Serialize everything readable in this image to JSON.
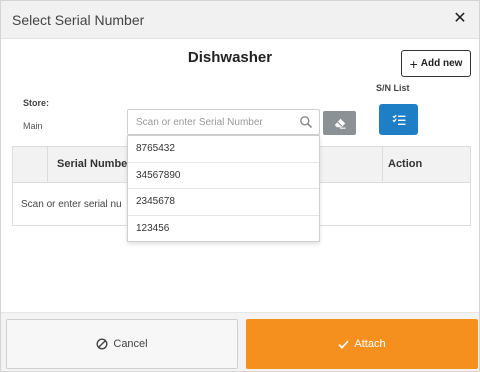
{
  "dialog": {
    "title": "Select Serial Number",
    "close_glyph": "✕"
  },
  "product": {
    "name": "Dishwasher"
  },
  "toolbar": {
    "add_new_label": "Add new",
    "sn_list_label": "S/N List"
  },
  "store": {
    "label": "Store:",
    "value": "Main"
  },
  "search": {
    "placeholder": "Scan or enter Serial Number",
    "value": ""
  },
  "table": {
    "columns": [
      "Serial Number",
      "Action"
    ],
    "empty_message": "Scan or enter serial nu"
  },
  "dropdown": {
    "options": [
      "8765432",
      "34567890",
      "2345678",
      "123456"
    ]
  },
  "footer": {
    "cancel_label": "Cancel",
    "attach_label": "Attach"
  },
  "colors": {
    "primary_blue": "#1f7fc6",
    "attach_orange": "#f5901f",
    "erase_gray": "#8c9196"
  },
  "icons": [
    "close-icon",
    "plus-icon",
    "list-check-icon",
    "search-icon",
    "eraser-icon",
    "cancel-circle-icon",
    "check-icon"
  ]
}
